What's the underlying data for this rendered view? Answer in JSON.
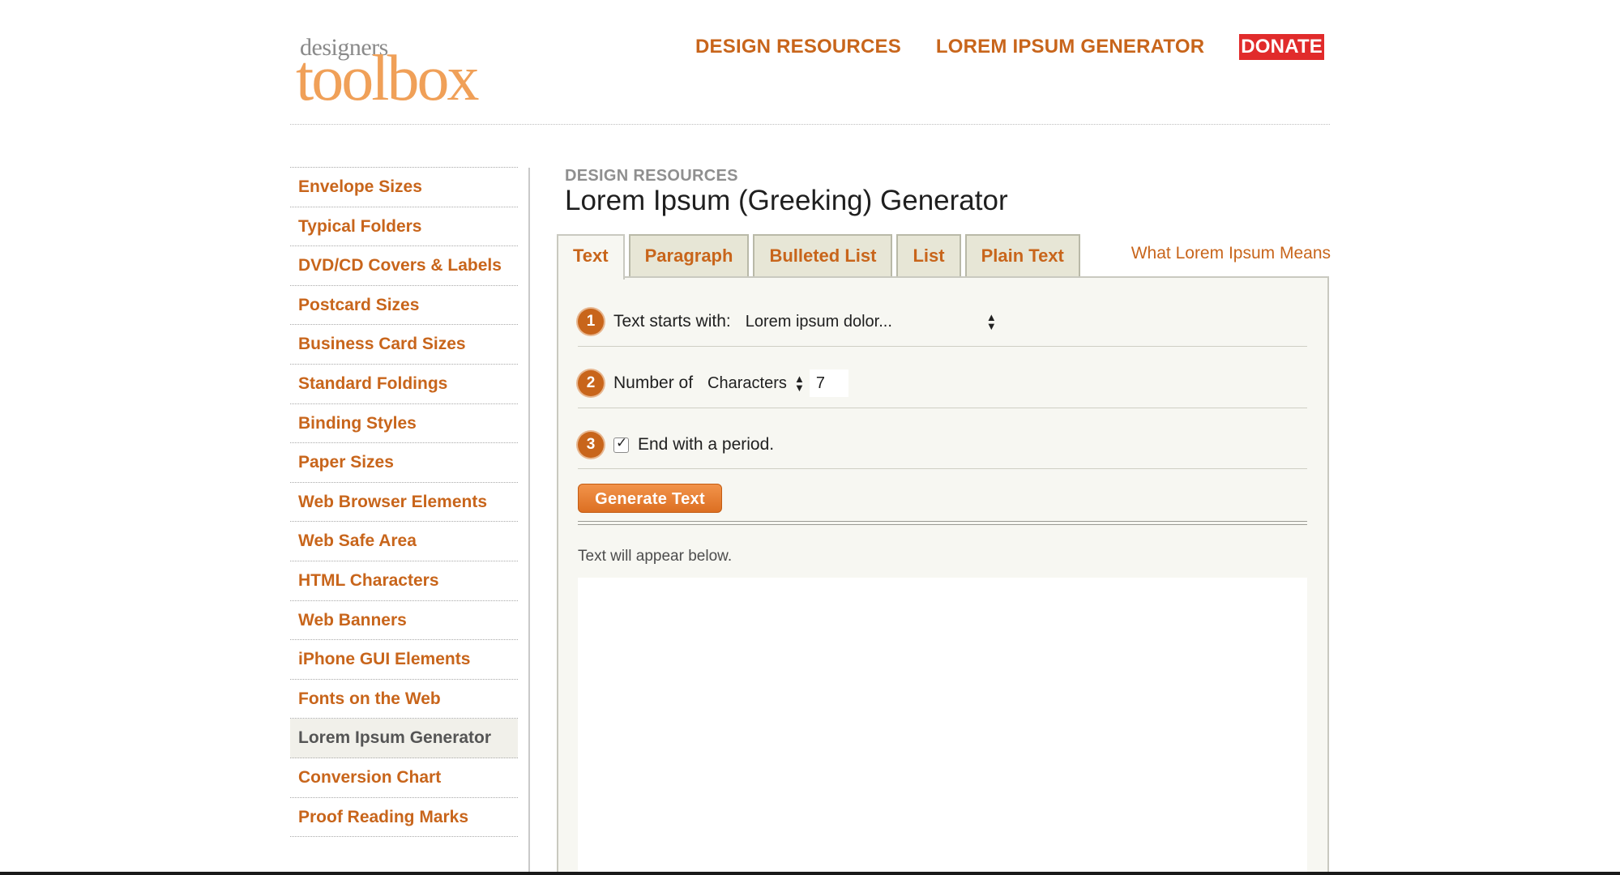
{
  "brand": {
    "logo_small": "designers",
    "logo_big": "toolbox",
    "colors": {
      "accent": "#c8651b",
      "donate_bg": "#e12b2b",
      "logo": "#f0a058"
    }
  },
  "top_nav": {
    "design_resources": "DESIGN RESOURCES",
    "lorem_ipsum_generator": "LOREM IPSUM GENERATOR",
    "donate": "DONATE"
  },
  "sidebar": {
    "items": [
      {
        "label": "Envelope Sizes"
      },
      {
        "label": "Typical Folders"
      },
      {
        "label": "DVD/CD Covers & Labels"
      },
      {
        "label": "Postcard Sizes"
      },
      {
        "label": "Business Card Sizes"
      },
      {
        "label": "Standard Foldings"
      },
      {
        "label": "Binding Styles"
      },
      {
        "label": "Paper Sizes"
      },
      {
        "label": "Web Browser Elements"
      },
      {
        "label": "Web Safe Area"
      },
      {
        "label": "HTML Characters"
      },
      {
        "label": "Web Banners"
      },
      {
        "label": "iPhone GUI Elements"
      },
      {
        "label": "Fonts on the Web"
      },
      {
        "label": "Lorem Ipsum Generator",
        "active": true
      },
      {
        "label": "Conversion Chart"
      },
      {
        "label": "Proof Reading Marks"
      }
    ]
  },
  "main": {
    "section_label": "DESIGN RESOURCES",
    "title": "Lorem Ipsum (Greeking) Generator",
    "tabs": [
      {
        "label": "Text",
        "active": true
      },
      {
        "label": "Paragraph"
      },
      {
        "label": "Bulleted List"
      },
      {
        "label": "List"
      },
      {
        "label": "Plain Text"
      }
    ],
    "what_link": "What Lorem Ipsum Means",
    "steps": {
      "step1": {
        "number": "1",
        "label": "Text starts with:",
        "selected": "Lorem ipsum dolor..."
      },
      "step2": {
        "number": "2",
        "label": "Number of",
        "unit_selected": "Characters",
        "count_value": "7"
      },
      "step3": {
        "number": "3",
        "label": "End with a period.",
        "checked": true
      }
    },
    "generate_button": "Generate Text",
    "hint": "Text will appear below."
  }
}
